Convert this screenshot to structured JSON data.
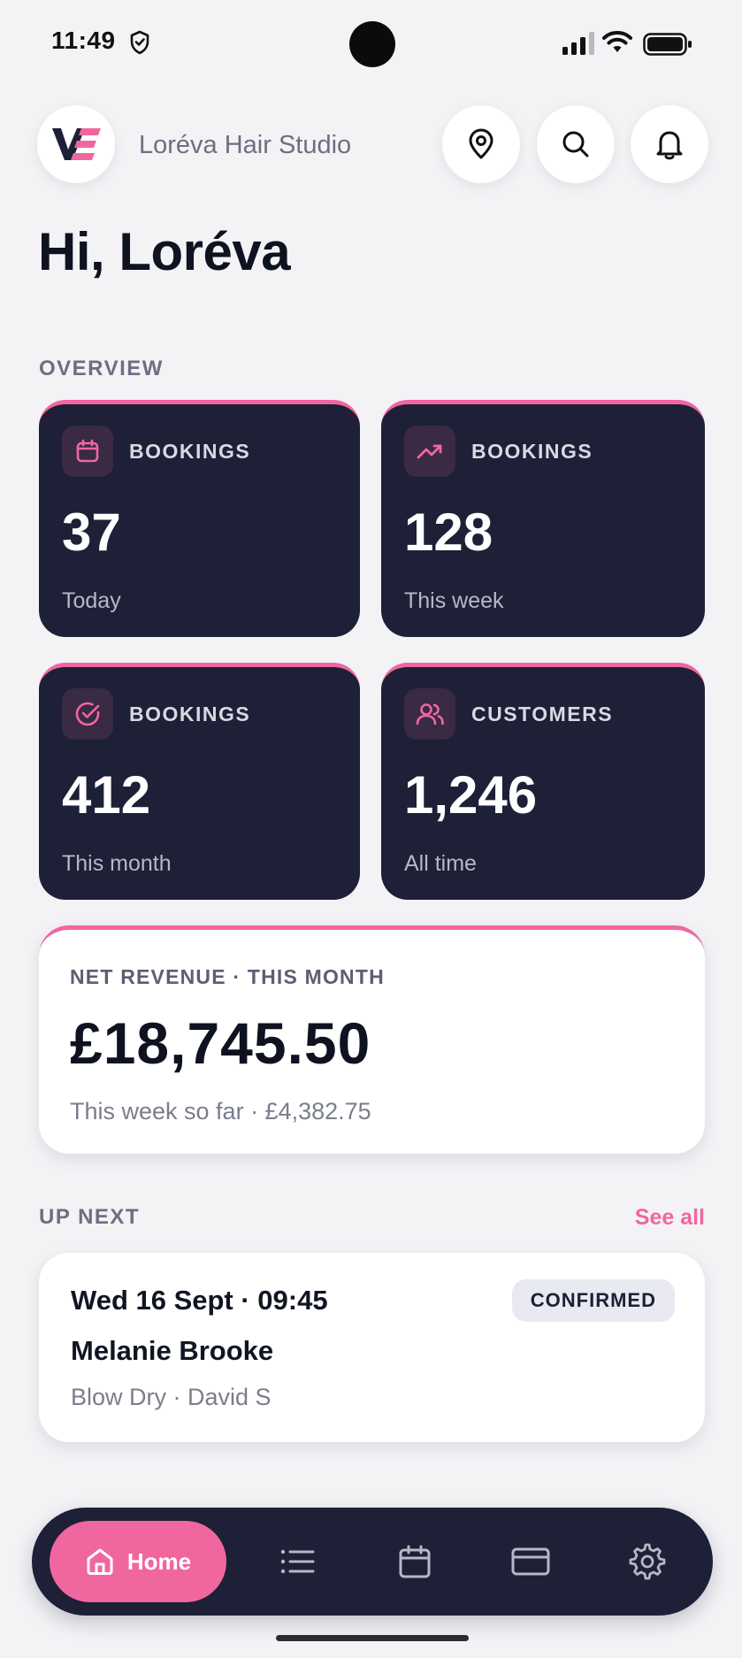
{
  "status_bar": {
    "time": "11:49"
  },
  "header": {
    "logo_text": "VE",
    "studio_name": "Loréva Hair Studio"
  },
  "greeting": "Hi, Loréva",
  "overview": {
    "section_title": "OVERVIEW",
    "cards": [
      {
        "icon": "calendar-icon",
        "label": "BOOKINGS",
        "value": "37",
        "sub": "Today"
      },
      {
        "icon": "trend-up-icon",
        "label": "BOOKINGS",
        "value": "128",
        "sub": "This week"
      },
      {
        "icon": "check-circle-icon",
        "label": "BOOKINGS",
        "value": "412",
        "sub": "This month"
      },
      {
        "icon": "users-icon",
        "label": "CUSTOMERS",
        "value": "1,246",
        "sub": "All time"
      }
    ]
  },
  "revenue": {
    "label": "NET REVENUE · THIS MONTH",
    "value": "£18,745.50",
    "sub": "This week so far · £4,382.75"
  },
  "up_next": {
    "section_title": "UP NEXT",
    "see_all": "See all",
    "appointment": {
      "when": "Wed 16 Sept · 09:45",
      "status": "CONFIRMED",
      "client": "Melanie Brooke",
      "service": "Blow Dry · David S"
    }
  },
  "bottom_nav": {
    "home_label": "Home",
    "items": [
      "home-icon",
      "list-icon",
      "calendar-icon",
      "card-icon",
      "gear-icon"
    ]
  },
  "colors": {
    "accent": "#f0679f",
    "navy": "#1d2036",
    "background": "#f3f3f6"
  }
}
